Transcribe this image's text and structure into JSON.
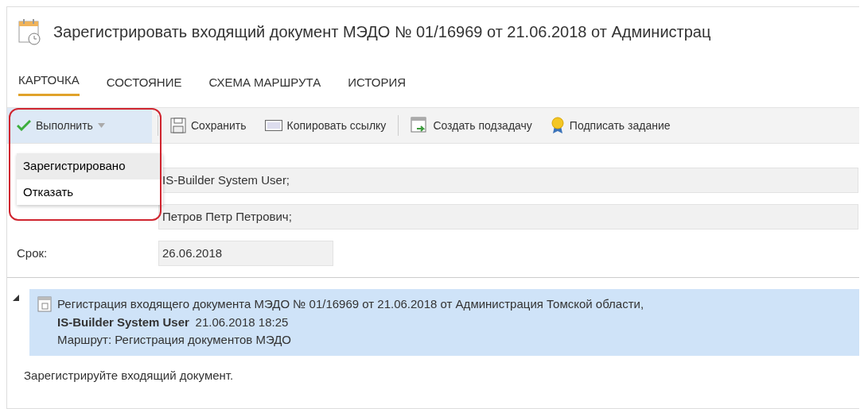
{
  "window": {
    "title": "Зарегистрировать входящий документ МЭДО № 01/16969 от 21.06.2018 от Администрац"
  },
  "tabs": [
    {
      "label": "КАРТОЧКА",
      "selected": true
    },
    {
      "label": "СОСТОЯНИЕ",
      "selected": false
    },
    {
      "label": "СХЕМА МАРШРУТА",
      "selected": false
    },
    {
      "label": "ИСТОРИЯ",
      "selected": false
    }
  ],
  "toolbar": [
    {
      "kind": "split",
      "label": "Выполнить",
      "expanded": true
    },
    {
      "kind": "save",
      "label": "Сохранить"
    },
    {
      "kind": "link",
      "label": "Копировать ссылку"
    },
    {
      "kind": "subtask",
      "label": "Создать подзадачу"
    },
    {
      "kind": "sign",
      "label": "Подписать задание"
    }
  ],
  "dropdown": [
    {
      "label": "Зарегистрировано",
      "selected": true
    },
    {
      "label": "Отказать",
      "selected": false
    }
  ],
  "fields": [
    {
      "value": "IS-Builder System User;",
      "wide": true
    },
    {
      "value": "Петров Петр Петрович;",
      "wide": true
    },
    {
      "label": "Срок:",
      "value": "26.06.2018",
      "wide": false
    }
  ],
  "task": {
    "expanded": true,
    "title": "Регистрация входящего документа МЭДО № 01/16969 от 21.06.2018 от Администрация Томской области,",
    "author": "IS-Builder System User",
    "time": "21.06.2018 18:25",
    "route": "Маршрут: Регистрация документов МЭДО"
  },
  "description": "Зарегистрируйте входящий документ."
}
